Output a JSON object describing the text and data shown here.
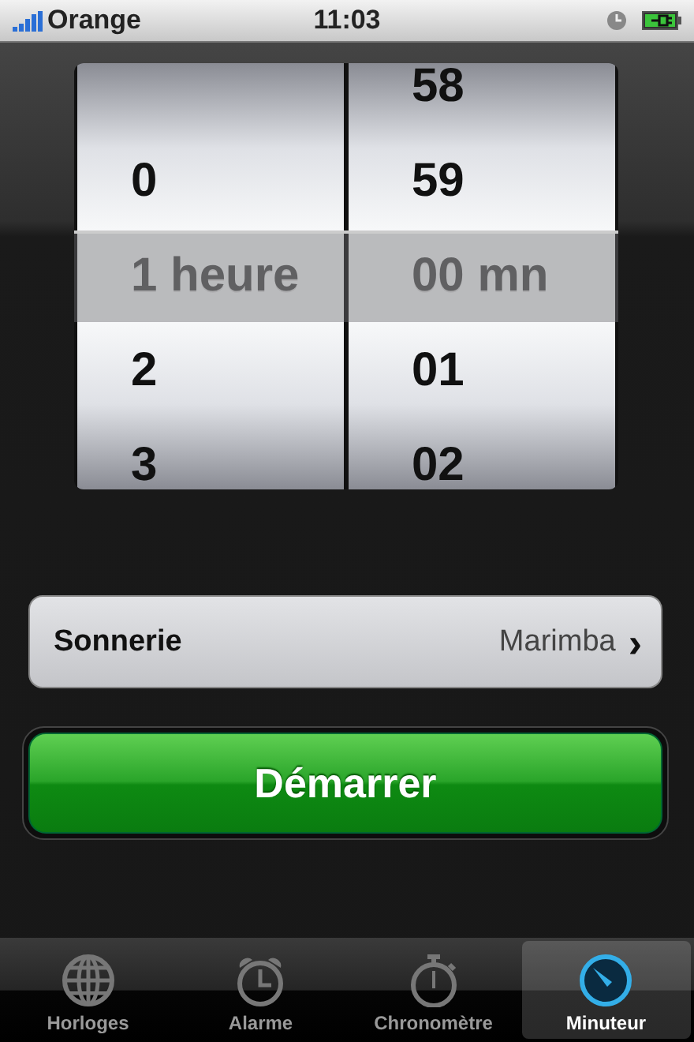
{
  "status_bar": {
    "carrier": "Orange",
    "time": "11:03"
  },
  "picker": {
    "columns": [
      {
        "items": [
          {
            "label": "0",
            "selected": false
          },
          {
            "label": "1 heure",
            "selected": true
          },
          {
            "label": "2",
            "selected": false
          },
          {
            "label": "3",
            "selected": false
          }
        ]
      },
      {
        "items": [
          {
            "label": "58",
            "selected": false
          },
          {
            "label": "59",
            "selected": false
          },
          {
            "label": "00 mn",
            "selected": true
          },
          {
            "label": "01",
            "selected": false
          },
          {
            "label": "02",
            "selected": false
          }
        ]
      }
    ]
  },
  "ringtone": {
    "label": "Sonnerie",
    "value": "Marimba",
    "chevron": "›"
  },
  "start_button": {
    "label": "Démarrer"
  },
  "tabs": [
    {
      "label": "Horloges",
      "kind": "globe",
      "selected": false
    },
    {
      "label": "Alarme",
      "kind": "alarm",
      "selected": false
    },
    {
      "label": "Chronomètre",
      "kind": "stopwatch",
      "selected": false
    },
    {
      "label": "Minuteur",
      "kind": "timer",
      "selected": true
    }
  ]
}
